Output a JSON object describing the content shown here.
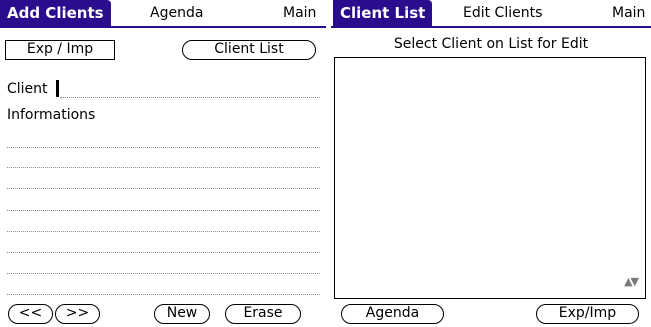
{
  "left": {
    "title": "Add Clients",
    "menu": [
      "Agenda",
      "Main"
    ],
    "buttons": {
      "exp_imp": "Exp / Imp",
      "client_list": "Client List"
    },
    "client_label": "Client",
    "info_label": "Informations",
    "bottom_buttons": [
      "<<",
      ">>",
      "New",
      "Erase"
    ]
  },
  "right": {
    "title": "Client List",
    "menu": [
      "Edit Clients",
      "Main"
    ],
    "subtitle": "Select Client on List for Edit",
    "scroll_arrows": "▲▼",
    "bottom_buttons": [
      "Agenda",
      "Exp/Imp"
    ]
  },
  "colors": {
    "title_bar": "#2a0d8c",
    "dotted_line": "#8a8a8a"
  },
  "icons": {
    "scroll": "up-down-arrows"
  }
}
